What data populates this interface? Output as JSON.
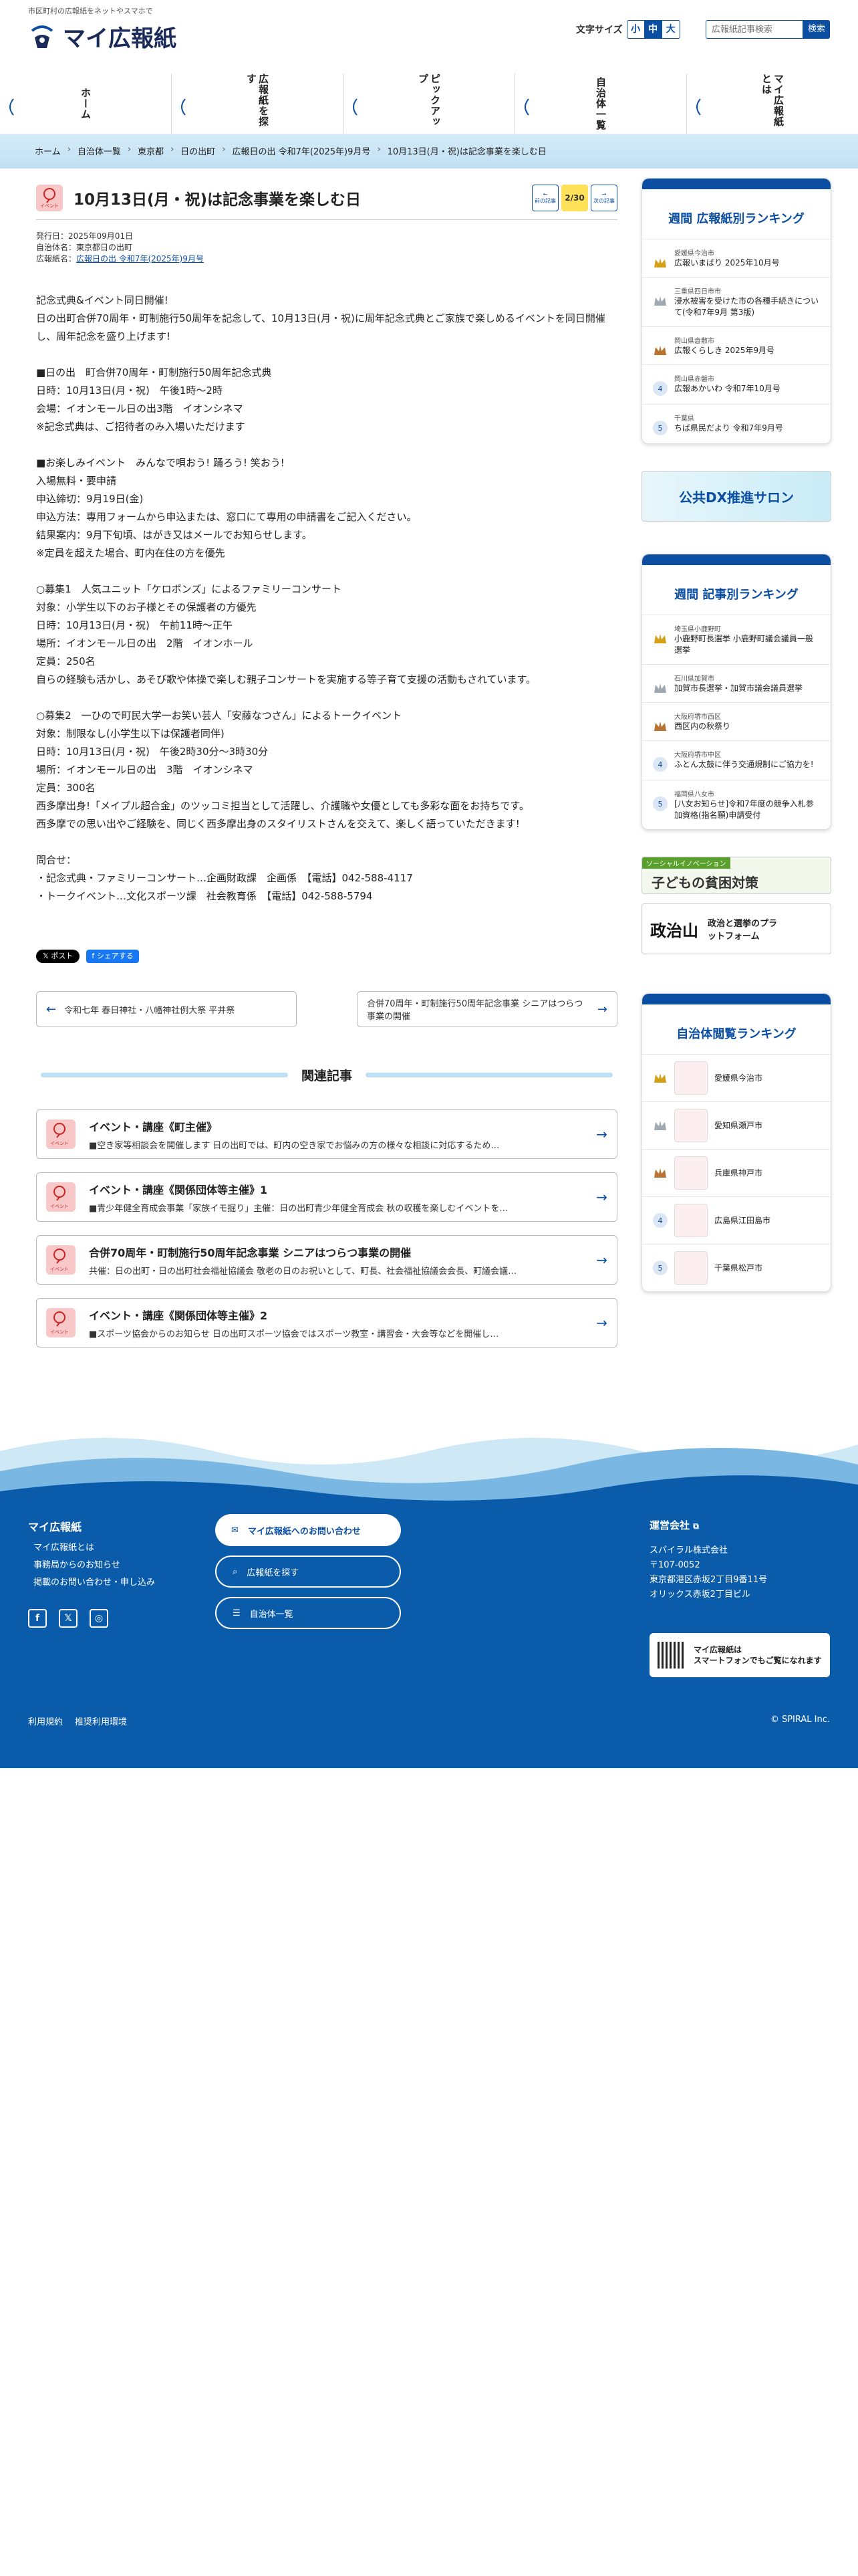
{
  "header": {
    "tagline": "市区町村の広報紙をネットやスマホで",
    "logo_text": "マイ広報紙",
    "font_size_label": "文字サイズ",
    "font_sizes": [
      "小",
      "中",
      "大"
    ],
    "search_placeholder": "広報紙記事検索",
    "search_button": "検索"
  },
  "gnav": [
    "ホーム",
    "広報紙を探す",
    "ピックアップ",
    "自治体一覧",
    "マイ広報紙とは"
  ],
  "breadcrumb": [
    "ホーム",
    "自治体一覧",
    "東京都",
    "日の出町",
    "広報日の出 令和7年(2025年)9月号",
    "10月13日(月・祝)は記念事業を楽しむ日"
  ],
  "article": {
    "category": "イベント",
    "title": "10月13日(月・祝)は記念事業を楽しむ日",
    "prev_label": "前の記事",
    "next_label": "次の記事",
    "page_count": "2/30",
    "issued": "発行日：2025年09月01日",
    "municipality": "自治体名：東京都日の出町",
    "paper_label": "広報紙名：",
    "paper_link": "広報日の出 令和7年(2025年)9月号",
    "body": "記念式典&イベント同日開催!\n日の出町合併70周年・町制施行50周年を記念して、10月13日(月・祝)に周年記念式典とご家族で楽しめるイベントを同日開催し、周年記念を盛り上げます!\n\n■日の出　町合併70周年・町制施行50周年記念式典\n日時：10月13日(月・祝)　午後1時〜2時\n会場：イオンモール日の出3階　イオンシネマ\n※記念式典は、ご招待者のみ入場いただけます\n\n■お楽しみイベント　みんなで唄おう! 踊ろう! 笑おう!\n入場無料・要申請\n申込締切：9月19日(金)\n申込方法：専用フォームから申込または、窓口にて専用の申請書をご記入ください。\n結果案内：9月下旬頃、はがき又はメールでお知らせします。\n※定員を超えた場合、町内在住の方を優先\n\n○募集1　人気ユニット「ケロポンズ」によるファミリーコンサート\n対象：小学生以下のお子様とその保護者の方優先\n日時：10月13日(月・祝)　午前11時〜正午\n場所：イオンモール日の出　2階　イオンホール\n定員：250名\n自らの経験も活かし、あそび歌や体操で楽しむ親子コンサートを実施する等子育て支援の活動もされています。\n\n○募集2　一ひので町民大学一お笑い芸人「安藤なつさん」によるトークイベント\n対象：制限なし(小学生以下は保護者同伴)\n日時：10月13日(月・祝)　午後2時30分〜3時30分\n場所：イオンモール日の出　3階　イオンシネマ\n定員：300名\n西多摩出身!「メイプル超合金」のツッコミ担当として活躍し、介護職や女優としても多彩な面をお持ちです。\n西多摩での思い出やご経験を、同じく西多摩出身のスタイリストさんを交えて、楽しく語っていただきます!\n\n問合せ：\n・記念式典・ファミリーコンサート…企画財政課　企画係　【電話】042-588-4117\n・トークイベント…文化スポーツ課　社会教育係　【電話】042-588-5794",
    "share_x": "𝕏 ポスト",
    "share_fb": "f シェアする",
    "prev_article": "令和七年 春日神社・八幡神社例大祭 平井祭",
    "next_article": "合併70周年・町制施行50周年記念事業 シニアはつらつ事業の開催"
  },
  "related": {
    "title": "関連記事",
    "items": [
      {
        "title": "イベント・講座《町主催》",
        "desc": "■空き家等相談会を開催します 日の出町では、町内の空き家でお悩みの方の様々な相談に対応するため…"
      },
      {
        "title": "イベント・講座《関係団体等主催》1",
        "desc": "■青少年健全育成会事業「家族イモ掘り」主催：日の出町青少年健全育成会 秋の収穫を楽しむイベントを…"
      },
      {
        "title": "合併70周年・町制施行50周年記念事業 シニアはつらつ事業の開催",
        "desc": "共催：日の出町・日の出町社会福祉協議会 敬老の日のお祝いとして、町長、社会福祉協議会会長、町議会議…"
      },
      {
        "title": "イベント・講座《関係団体等主催》2",
        "desc": "■スポーツ協会からのお知らせ 日の出町スポーツ協会ではスポーツ教室・講習会・大会等などを開催し…"
      }
    ]
  },
  "sidebar": {
    "weekly_paper": {
      "title": "週間 広報紙別ランキング",
      "items": [
        {
          "rank": "1",
          "sub": "愛媛県今治市",
          "main": "広報いまばり 2025年10月号"
        },
        {
          "rank": "2",
          "sub": "三重県四日市市",
          "main": "浸水被害を受けた市の各種手続きについて(令和7年9月 第3版)"
        },
        {
          "rank": "3",
          "sub": "岡山県倉敷市",
          "main": "広報くらしき 2025年9月号"
        },
        {
          "rank": "4",
          "sub": "岡山県赤磐市",
          "main": "広報あかいわ 令和7年10月号"
        },
        {
          "rank": "5",
          "sub": "千葉県",
          "main": "ちば県民だより 令和7年9月号"
        }
      ]
    },
    "banner_dx": "公共DX推進サロン",
    "weekly_article": {
      "title": "週間 記事別ランキング",
      "items": [
        {
          "rank": "1",
          "sub": "埼玉県小鹿野町",
          "main": "小鹿野町長選挙 小鹿野町議会議員一般選挙"
        },
        {
          "rank": "2",
          "sub": "石川県加賀市",
          "main": "加賀市長選挙・加賀市議会議員選挙"
        },
        {
          "rank": "3",
          "sub": "大阪府堺市西区",
          "main": "西区内の秋祭り"
        },
        {
          "rank": "4",
          "sub": "大阪府堺市中区",
          "main": "ふとん太鼓に伴う交通規制にご協力を!"
        },
        {
          "rank": "5",
          "sub": "福岡県八女市",
          "main": "[八女お知らせ]令和7年度の競争入札参加資格(指名願)申請受付"
        }
      ]
    },
    "banner_social": "子どもの貧困対策",
    "banner_social_tag": "ソーシャルイノベーション",
    "banner_seiji": "政治と選挙のプラットフォーム",
    "banner_seiji_logo": "政治山",
    "browse": {
      "title": "自治体閲覧ランキング",
      "items": [
        {
          "rank": "1",
          "main": "愛媛県今治市"
        },
        {
          "rank": "2",
          "main": "愛知県瀬戸市"
        },
        {
          "rank": "3",
          "main": "兵庫県神戸市"
        },
        {
          "rank": "4",
          "main": "広島県江田島市"
        },
        {
          "rank": "5",
          "main": "千葉県松戸市"
        }
      ]
    }
  },
  "footer": {
    "name": "マイ広報紙",
    "links": [
      "マイ広報紙とは",
      "事務局からのお知らせ",
      "掲載のお問い合わせ・申し込み"
    ],
    "btn_contact": "マイ広報紙へのお問い合わせ",
    "btn_search": "広報紙を探す",
    "btn_list": "自治体一覧",
    "company_label": "運営会社",
    "company_name": "スパイラル株式会社",
    "zip": "〒107-0052",
    "address1": "東京都港区赤坂2丁目9番11号",
    "address2": "オリックス赤坂2丁目ビル",
    "qr_line1": "マイ広報紙は",
    "qr_line2": "スマートフォンでもご覧になれます",
    "bottom_links": [
      "利用規約",
      "推奨利用環境"
    ],
    "copyright": "© SPIRAL Inc."
  }
}
